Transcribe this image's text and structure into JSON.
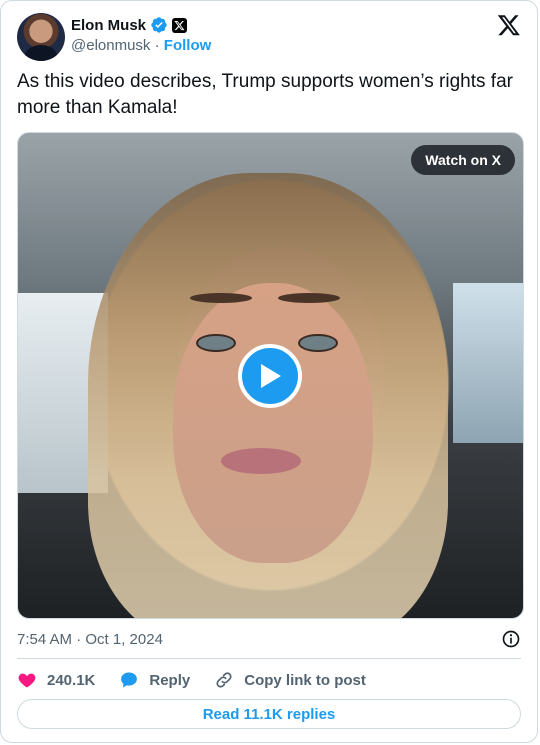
{
  "author": {
    "name": "Elon Musk",
    "handle": "@elonmusk",
    "separator": "·",
    "follow_label": "Follow"
  },
  "tweet": {
    "text": "As this video describes, Trump supports women’s rights far more than Kamala!"
  },
  "media": {
    "watch_label": "Watch on X",
    "play_icon": "play-icon"
  },
  "meta": {
    "timestamp": "7:54 AM · Oct 1, 2024"
  },
  "actions": {
    "likes": "240.1K",
    "reply_label": "Reply",
    "copy_link_label": "Copy link to post"
  },
  "replies_button": {
    "label": "Read 11.1K replies"
  },
  "colors": {
    "accent": "#1d9bf0",
    "like": "#f91880",
    "text": "#0f1419",
    "muted": "#536471",
    "border": "#cfd9de"
  }
}
